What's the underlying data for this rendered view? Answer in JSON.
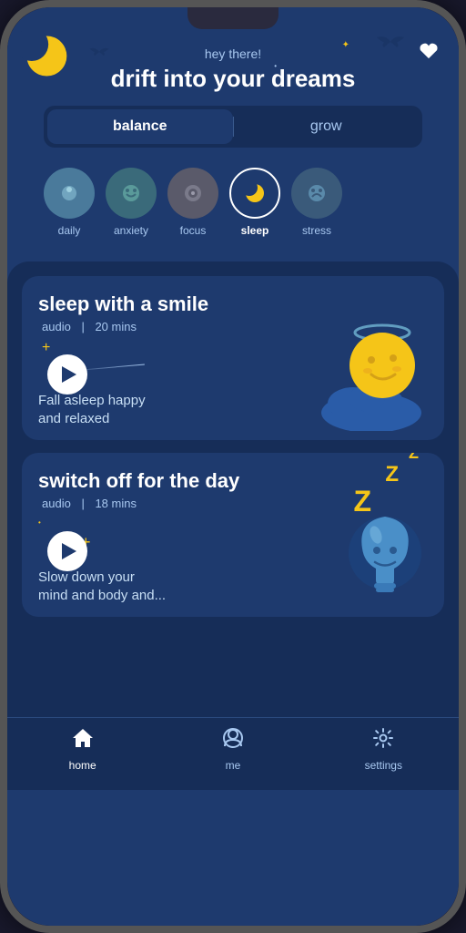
{
  "app": {
    "greeting": "hey there!",
    "title": "drift into your dreams",
    "heart_icon": "♥"
  },
  "tabs": {
    "options": [
      "balance",
      "grow"
    ],
    "active": "balance"
  },
  "categories": [
    {
      "id": "daily",
      "label": "daily",
      "icon": "🌅",
      "color": "#4a7a9b",
      "active": false
    },
    {
      "id": "anxiety",
      "label": "anxiety",
      "icon": "😌",
      "color": "#3a6a7a",
      "active": false
    },
    {
      "id": "focus",
      "label": "focus",
      "icon": "🎯",
      "color": "#5a5a6a",
      "active": false
    },
    {
      "id": "sleep",
      "label": "sleep",
      "icon": "🌙",
      "color": "#1e3a6e",
      "active": true
    },
    {
      "id": "stress",
      "label": "stress",
      "icon": "💆",
      "color": "#3a5a7a",
      "active": false
    }
  ],
  "cards": [
    {
      "id": "card1",
      "title": "sleep with a smile",
      "type": "audio",
      "duration": "20 mins",
      "description": "Fall asleep happy\nand relaxed"
    },
    {
      "id": "card2",
      "title": "switch off for the day",
      "type": "audio",
      "duration": "18 mins",
      "description": "Slow down your\nmind and body and..."
    }
  ],
  "nav": {
    "items": [
      {
        "id": "home",
        "label": "home",
        "icon": "🏠",
        "active": true
      },
      {
        "id": "me",
        "label": "me",
        "icon": "👤",
        "active": false
      },
      {
        "id": "settings",
        "label": "settings",
        "icon": "⚙",
        "active": false
      }
    ]
  }
}
